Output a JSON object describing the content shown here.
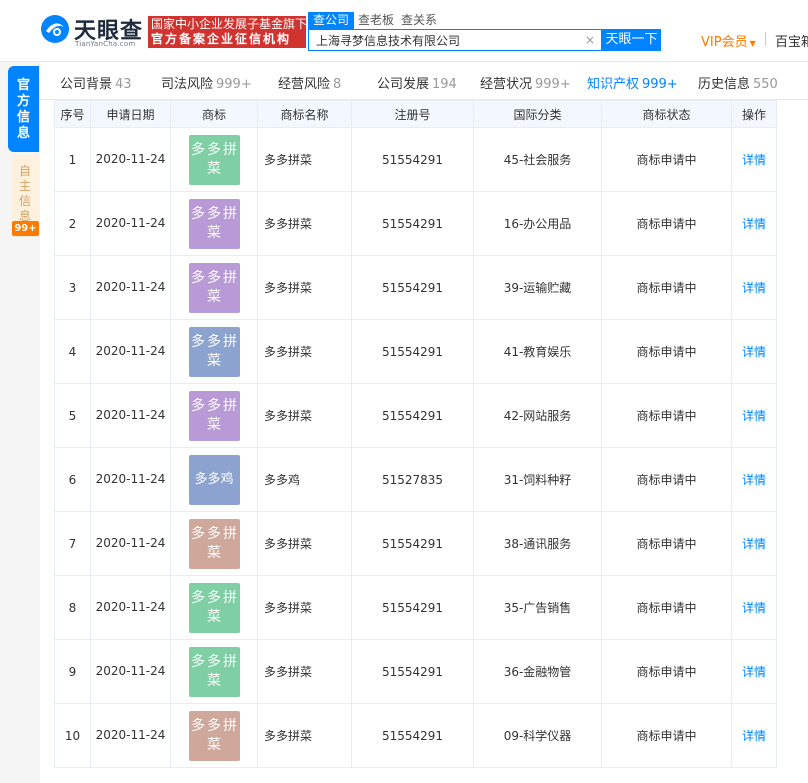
{
  "header": {
    "logo": {
      "cn": "天眼查",
      "en": "TianYanCha.com"
    },
    "banner": {
      "line1": "国家中小企业发展子基金旗下",
      "line2": "官方备案企业征信机构"
    },
    "search_tabs": [
      "查公司",
      "查老板",
      "查关系"
    ],
    "search": {
      "value": "上海寻梦信息技术有限公司",
      "clear_icon": "×",
      "button": "天眼一下"
    },
    "vip": "VIP会员",
    "baike": "百宝箱"
  },
  "side_nav": {
    "official": "官方信息",
    "own": "自主信息",
    "own_badge": "99+"
  },
  "tabs": [
    {
      "label": "公司背景",
      "count": "43"
    },
    {
      "label": "司法风险",
      "count": "999+"
    },
    {
      "label": "经营风险",
      "count": "8"
    },
    {
      "label": "公司发展",
      "count": "194"
    },
    {
      "label": "经营状况",
      "count": "999+"
    },
    {
      "label": "知识产权",
      "count": "999+",
      "active": true
    },
    {
      "label": "历史信息",
      "count": "550"
    }
  ],
  "table": {
    "columns": [
      "序号",
      "申请日期",
      "商标",
      "商标名称",
      "注册号",
      "国际分类",
      "商标状态",
      "操作"
    ],
    "rows": [
      {
        "no": "1",
        "date": "2020-11-24",
        "logo_text": "多多拼菜",
        "logo_color": "#7fcfa4",
        "name": "多多拼菜",
        "reg": "51554291",
        "cls": "45-社会服务",
        "status": "商标申请中",
        "op": "详情"
      },
      {
        "no": "2",
        "date": "2020-11-24",
        "logo_text": "多多拼菜",
        "logo_color": "#b79ad6",
        "name": "多多拼菜",
        "reg": "51554291",
        "cls": "16-办公用品",
        "status": "商标申请中",
        "op": "详情"
      },
      {
        "no": "3",
        "date": "2020-11-24",
        "logo_text": "多多拼菜",
        "logo_color": "#b79ad6",
        "name": "多多拼菜",
        "reg": "51554291",
        "cls": "39-运输贮藏",
        "status": "商标申请中",
        "op": "详情"
      },
      {
        "no": "4",
        "date": "2020-11-24",
        "logo_text": "多多拼菜",
        "logo_color": "#8da3cf",
        "name": "多多拼菜",
        "reg": "51554291",
        "cls": "41-教育娱乐",
        "status": "商标申请中",
        "op": "详情"
      },
      {
        "no": "5",
        "date": "2020-11-24",
        "logo_text": "多多拼菜",
        "logo_color": "#b79ad6",
        "name": "多多拼菜",
        "reg": "51554291",
        "cls": "42-网站服务",
        "status": "商标申请中",
        "op": "详情"
      },
      {
        "no": "6",
        "date": "2020-11-24",
        "logo_text": "多多鸡",
        "logo_color": "#8da3cf",
        "name": "多多鸡",
        "reg": "51527835",
        "cls": "31-饲料种籽",
        "status": "商标申请中",
        "op": "详情"
      },
      {
        "no": "7",
        "date": "2020-11-24",
        "logo_text": "多多拼菜",
        "logo_color": "#cfa79b",
        "name": "多多拼菜",
        "reg": "51554291",
        "cls": "38-通讯服务",
        "status": "商标申请中",
        "op": "详情"
      },
      {
        "no": "8",
        "date": "2020-11-24",
        "logo_text": "多多拼菜",
        "logo_color": "#7fcfa4",
        "name": "多多拼菜",
        "reg": "51554291",
        "cls": "35-广告销售",
        "status": "商标申请中",
        "op": "详情"
      },
      {
        "no": "9",
        "date": "2020-11-24",
        "logo_text": "多多拼菜",
        "logo_color": "#7fcfa4",
        "name": "多多拼菜",
        "reg": "51554291",
        "cls": "36-金融物管",
        "status": "商标申请中",
        "op": "详情"
      },
      {
        "no": "10",
        "date": "2020-11-24",
        "logo_text": "多多拼菜",
        "logo_color": "#cfa79b",
        "name": "多多拼菜",
        "reg": "51554291",
        "cls": "09-科学仪器",
        "status": "商标申请中",
        "op": "详情"
      }
    ]
  }
}
